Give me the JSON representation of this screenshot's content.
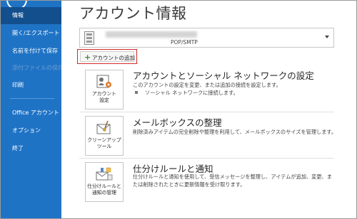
{
  "nav": {
    "items": [
      {
        "label": "情報",
        "active": true
      },
      {
        "label": "開く/エクスポート"
      },
      {
        "label": "名前を付けて保存"
      },
      {
        "label": "添付ファイルの保存",
        "disabled": true
      },
      {
        "label": "印刷"
      },
      {
        "label": "Office アカウント"
      },
      {
        "label": "オプション"
      },
      {
        "label": "終了"
      }
    ]
  },
  "main": {
    "title": "アカウント情報",
    "account_selector": {
      "type_label": "POP/SMTP"
    },
    "add_account_label": "アカウントの追加",
    "sections": [
      {
        "tile_label": "アカウント\n設定",
        "title": "アカウントとソーシャル ネットワークの設定",
        "description": "このアカウントの設定を変更、または追加の接続を設定します。",
        "bullet": "ソーシャル ネットワークに接続します。"
      },
      {
        "tile_label": "クリーンアップ\nツール",
        "title": "メールボックスの整理",
        "description": "削除済みアイテムの完全削除や整理を利用して、メールボックスのサイズを管理します。"
      },
      {
        "tile_label": "仕分けルールと\n通知の管理",
        "title": "仕分けルールと通知",
        "description": "仕分けルールと通知を使用して、受信メッセージを整理し、アイテムが追加、変更、または削除されたときに更新情報を受け取ります。"
      }
    ]
  },
  "colors": {
    "nav_bg": "#1f73c5",
    "nav_active": "#134f8c",
    "highlight_border": "#d42a2a",
    "plus_green": "#3d8c3a"
  }
}
